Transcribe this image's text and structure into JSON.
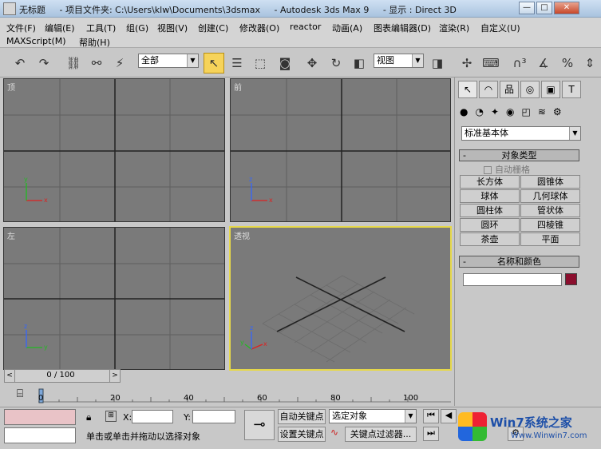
{
  "window": {
    "title": "无标题",
    "project": "- 项目文件夹: C:\\Users\\klw\\Documents\\3dsmax",
    "app": "- Autodesk 3ds Max 9",
    "display": "- 显示 : Direct 3D",
    "min": "—",
    "max": "□",
    "close": "✕"
  },
  "menu": {
    "row1": [
      "文件(F)",
      "编辑(E)",
      "工具(T)",
      "组(G)",
      "视图(V)",
      "创建(C)",
      "修改器(O)",
      "reactor",
      "动画(A)",
      "图表编辑器(D)",
      "渲染(R)",
      "自定义(U)"
    ],
    "row2": [
      "MAXScript(M)",
      "帮助(H)"
    ]
  },
  "toolbar": {
    "filter_combo": "全部",
    "coord_combo": "视图"
  },
  "viewports": {
    "top": "顶",
    "front": "前",
    "left": "左",
    "perspective": "透视"
  },
  "command_panel": {
    "category": "标准基本体",
    "object_type": "对象类型",
    "autogrid": "自动栅格",
    "buttons": [
      "长方体",
      "圆锥体",
      "球体",
      "几何球体",
      "圆柱体",
      "管状体",
      "圆环",
      "四棱锥",
      "茶壶",
      "平面"
    ],
    "name_color": "名称和颜色",
    "color": "#8b0f2e"
  },
  "timeline": {
    "frame": "0 / 100",
    "ticks": [
      "0",
      "20",
      "40",
      "60",
      "80",
      "100"
    ]
  },
  "status": {
    "x_label": "X:",
    "y_label": "Y:",
    "autokey": "自动关键点",
    "setkey": "设置关键点",
    "selected": "选定对象",
    "keyfilter": "关键点过滤器...",
    "prompt": "单击或单击并拖动以选择对象",
    "watermark": "Win7系统之家",
    "watermark_url": "Www.Winwin7.com"
  }
}
